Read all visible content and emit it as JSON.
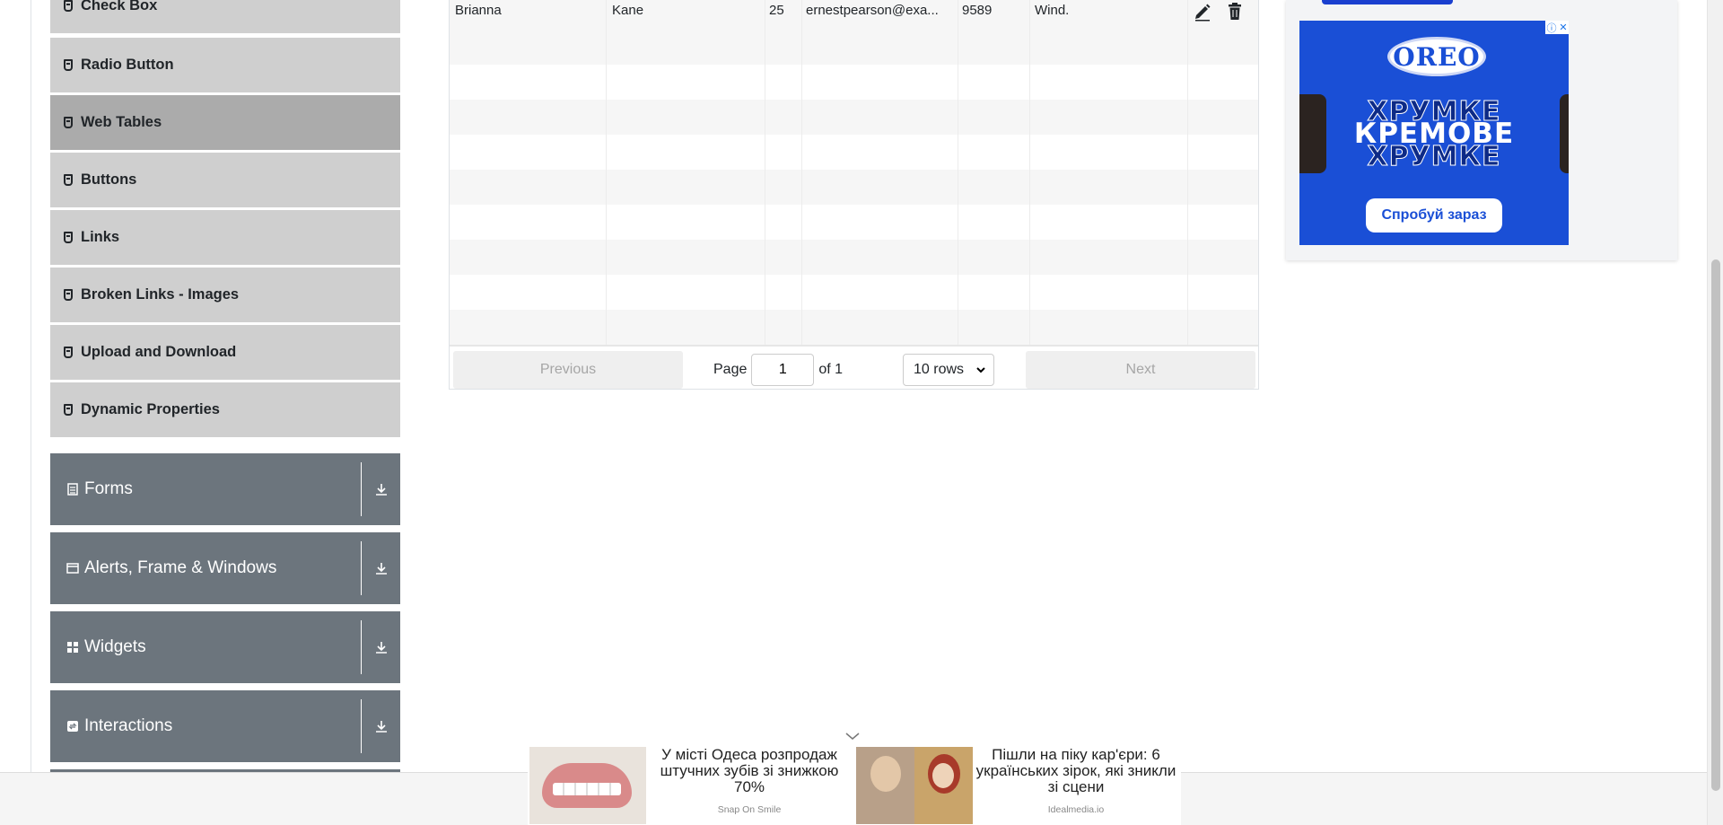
{
  "sidebar": {
    "elements_items": [
      {
        "label": "Check Box",
        "active": false
      },
      {
        "label": "Radio Button",
        "active": false
      },
      {
        "label": "Web Tables",
        "active": true
      },
      {
        "label": "Buttons",
        "active": false
      },
      {
        "label": "Links",
        "active": false
      },
      {
        "label": "Broken Links - Images",
        "active": false
      },
      {
        "label": "Upload and Download",
        "active": false
      },
      {
        "label": "Dynamic Properties",
        "active": false
      }
    ],
    "groups": [
      {
        "label": "Forms",
        "icon": "form-icon"
      },
      {
        "label": "Alerts, Frame & Windows",
        "icon": "window-icon"
      },
      {
        "label": "Widgets",
        "icon": "widgets-icon"
      },
      {
        "label": "Interactions",
        "icon": "interactions-icon"
      }
    ]
  },
  "table": {
    "rows": [
      {
        "first_name": "Brianna",
        "last_name": "Kane",
        "age": "25",
        "email": "ernestpearson@exa...",
        "salary": "9589",
        "department": "Wind."
      }
    ],
    "empty_rows": 9
  },
  "pagination": {
    "previous_label": "Previous",
    "page_label": "Page",
    "current_page": "1",
    "of_label": "of 1",
    "rows_select": "10 rows",
    "next_label": "Next"
  },
  "right_ad": {
    "brand": "OREO",
    "lines": [
      "ХРУМКЕ",
      "КРЕМОВЕ",
      "ХРУМКЕ"
    ],
    "cta": "Спробуй зараз",
    "bg_color": "#1a4fd6"
  },
  "bottom_ads": [
    {
      "text": "У місті Одеса розпродаж штучних зубів зі знижкою 70%",
      "source": "Snap On Smile"
    },
    {
      "text": "Пішли на піку кар'єри: 6 українських зірок, які зникли зі сцени",
      "source": "Idealmedia.io"
    }
  ]
}
